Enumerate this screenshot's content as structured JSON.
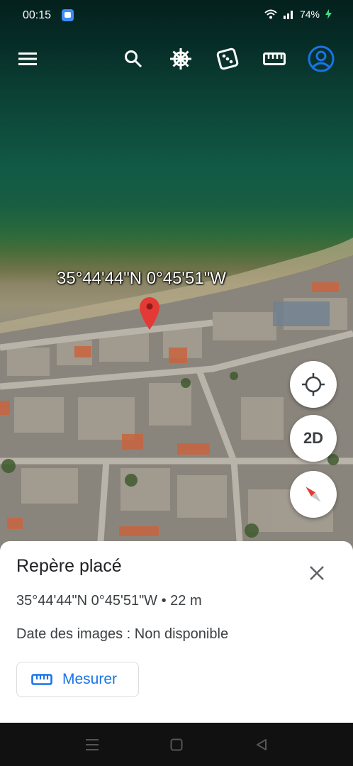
{
  "status_bar": {
    "time": "00:15",
    "battery": "74%"
  },
  "toolbar": {
    "icons": [
      "menu-icon",
      "search-icon",
      "voyager-wheel-icon",
      "dice-icon",
      "ruler-icon",
      "account-icon"
    ],
    "accent_color": "#1a73e8"
  },
  "map": {
    "coordinate_label": "35°44'44\"N 0°45'51\"W",
    "marker_color": "#e53935",
    "view_mode_label": "2D"
  },
  "sheet": {
    "title": "Repère placé",
    "coordinates": "35°44'44\"N 0°45'51\"W • 22 m",
    "image_date": "Date des images : Non disponible",
    "measure_label": "Mesurer"
  }
}
